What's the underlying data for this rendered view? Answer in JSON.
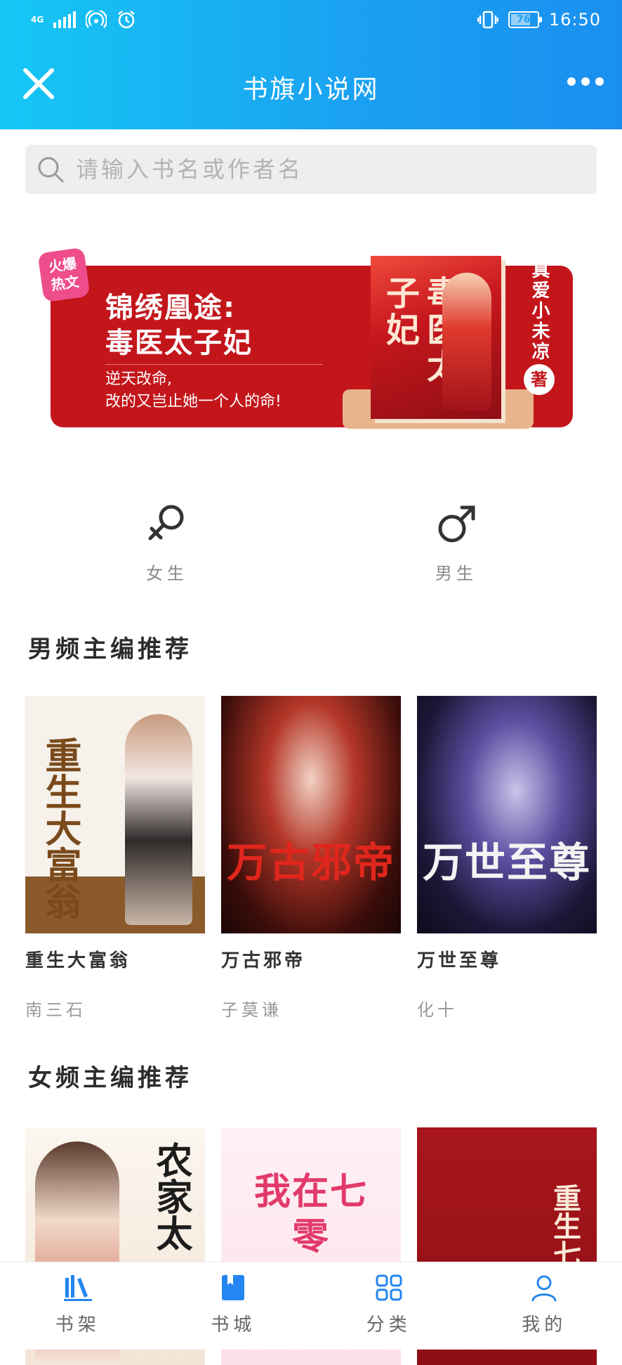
{
  "status_bar": {
    "network": "4G",
    "battery": "76",
    "battery_level": 0.76,
    "time": "16:50",
    "icons": [
      "signal-icon",
      "hotspot-icon",
      "alarm-icon",
      "vibrate-icon",
      "battery-icon"
    ]
  },
  "app_bar": {
    "title": "书旗小说网",
    "close_icon": "close-icon",
    "more_icon": "more-icon"
  },
  "search": {
    "placeholder": "请输入书名或作者名",
    "icon": "search-icon"
  },
  "banner": {
    "badge": "火爆\n热文",
    "title_line1": "锦绣凰途:",
    "title_line2": "毒医太子妃",
    "subtitle_line1": "逆天改命,",
    "subtitle_line2": "改的又岂止她一个人的命!",
    "cover_text": "毒医太子妃",
    "author": "真爱小未凉",
    "author_suffix": "著",
    "colors": {
      "band": "#c3161b",
      "badge": "#ee4d8c",
      "stand": "#e8b48c"
    }
  },
  "gender": {
    "female": {
      "label": "女生",
      "icon": "female-icon"
    },
    "male": {
      "label": "男生",
      "icon": "male-icon"
    }
  },
  "sections": [
    {
      "title": "男频主编推荐",
      "books": [
        {
          "title": "重生大富翁",
          "author": "南三石",
          "cover_text": "重生大富翁"
        },
        {
          "title": "万古邪帝",
          "author": "子莫谦",
          "cover_text": "万古邪帝"
        },
        {
          "title": "万世至尊",
          "author": "化十",
          "cover_text": "万世至尊"
        }
      ]
    },
    {
      "title": "女频主编推荐",
      "books": [
        {
          "cover_text": "农家太"
        },
        {
          "cover_text": "我在七零"
        },
        {
          "cover_text": "重生七"
        }
      ]
    }
  ],
  "bottom_nav": [
    {
      "label": "书架",
      "icon": "bookshelf-icon",
      "active": true
    },
    {
      "label": "书城",
      "icon": "bookstore-icon",
      "active": true
    },
    {
      "label": "分类",
      "icon": "category-icon",
      "active": false
    },
    {
      "label": "我的",
      "icon": "profile-icon",
      "active": false
    }
  ],
  "colors": {
    "accent": "#1a8ff0",
    "header_gradient_start": "#16c7f5",
    "header_gradient_end": "#1a8ff0",
    "search_bg": "#eeeeef"
  }
}
